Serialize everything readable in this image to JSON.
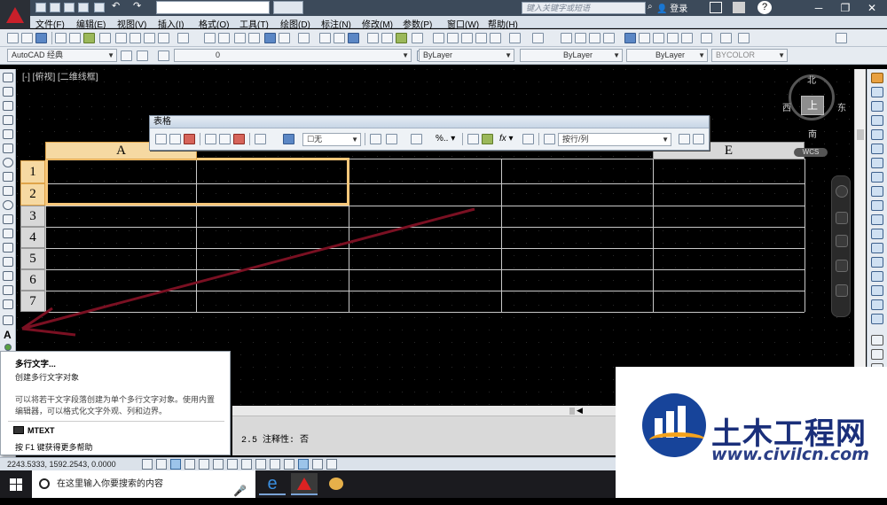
{
  "titlebar": {
    "workspace": "AutoCAD 经典",
    "search_placeholder": "键入关键字或短语",
    "login": "登录",
    "help": "?"
  },
  "menu": [
    "文件(F)",
    "编辑(E)",
    "视图(V)",
    "插入(I)",
    "格式(O)",
    "工具(T)",
    "绘图(D)",
    "标注(N)",
    "修改(M)",
    "参数(P)",
    "窗口(W)",
    "帮助(H)"
  ],
  "properties_bar": {
    "workspace_combo": "AutoCAD 经典",
    "layer_combo": "0",
    "color_combo": "ByLayer",
    "linetype_combo": "ByLayer",
    "lineweight_combo": "ByLayer",
    "plotstyle_combo": "BYCOLOR"
  },
  "viewport": {
    "label": "[-] [俯视] [二维线框]"
  },
  "table_toolbar": {
    "title": "表格",
    "border_combo": "无",
    "format_combo": "按行/列"
  },
  "table": {
    "columns": [
      "A",
      "E"
    ],
    "rows": [
      "1",
      "2",
      "3",
      "4",
      "5",
      "6",
      "7"
    ]
  },
  "viewcube": {
    "north": "北",
    "south": "南",
    "east": "东",
    "west": "西",
    "face": "上",
    "wcs": "WCS"
  },
  "tooltip": {
    "title": "多行文字...",
    "subtitle": "创建多行文字对象",
    "description": "可以将若干文字段落创建为单个多行文字对象。使用内置编辑器，可以格式化文字外观、列和边界。",
    "command": "MTEXT",
    "help": "按 F1 键获得更多帮助"
  },
  "command_line": {
    "text": "2.5  注释性:  否"
  },
  "statusbar": {
    "coordinates": "2243.5333, 1592.2543, 0.0000"
  },
  "taskbar": {
    "search_placeholder": "在这里输入你要搜索的内容"
  },
  "watermark": {
    "title": "土木工程网",
    "url": "www.civilcn.com"
  },
  "colors": {
    "selection": "#f6d9a2",
    "table_lines": "#c8c8c8",
    "arrow": "#7a1022",
    "brand_blue": "#17449a"
  }
}
